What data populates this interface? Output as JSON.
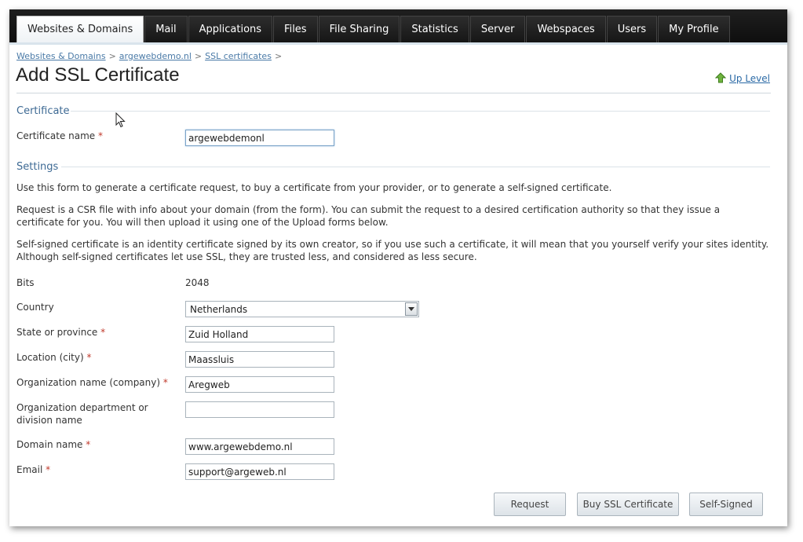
{
  "nav": {
    "tabs": [
      {
        "label": "Websites & Domains",
        "active": true
      },
      {
        "label": "Mail"
      },
      {
        "label": "Applications"
      },
      {
        "label": "Files"
      },
      {
        "label": "File Sharing"
      },
      {
        "label": "Statistics"
      },
      {
        "label": "Server"
      },
      {
        "label": "Webspaces"
      },
      {
        "label": "Users"
      },
      {
        "label": "My Profile"
      }
    ]
  },
  "breadcrumb": {
    "items": [
      "Websites & Domains",
      "argewebdemo.nl",
      "SSL certificates"
    ],
    "separator": ">"
  },
  "page": {
    "title": "Add SSL Certificate",
    "up_level": "Up Level"
  },
  "certificate": {
    "heading": "Certificate",
    "name_label": "Certificate name",
    "name_value": "argewebdemonl"
  },
  "settings": {
    "heading": "Settings",
    "intro": "Use this form to generate a certificate request, to buy a certificate from your provider, or to generate a self-signed certificate.",
    "csr_text": "Request is a CSR file with info about your domain (from the form). You can submit the request to a desired certification authority so that they issue a certificate for you. You will then upload it using one of the Upload forms below.",
    "selfsigned_text": "Self-signed certificate is an identity certificate signed by its own creator, so if you use such a certificate, it will mean that you yourself verify your sites identity. Although self-signed certificates let use SSL, they are trusted less, and considered as less secure.",
    "bits_label": "Bits",
    "bits_value": "2048",
    "country_label": "Country",
    "country_value": "Netherlands",
    "state_label": "State or province",
    "state_value": "Zuid Holland",
    "city_label": "Location (city)",
    "city_value": "Maassluis",
    "org_label": "Organization name (company)",
    "org_value": "Aregweb",
    "dept_label": "Organization department or division name",
    "dept_value": "",
    "domain_label": "Domain name",
    "domain_value": "www.argewebdemo.nl",
    "email_label": "Email",
    "email_value": "support@argeweb.nl"
  },
  "required_mark": "*",
  "buttons": {
    "request": "Request",
    "buy": "Buy SSL Certificate",
    "self_signed": "Self-Signed"
  },
  "colors": {
    "nav_bg": "#151515",
    "section_heading": "#3e6a94",
    "link": "#4a7aa7",
    "required": "#c0392b"
  }
}
